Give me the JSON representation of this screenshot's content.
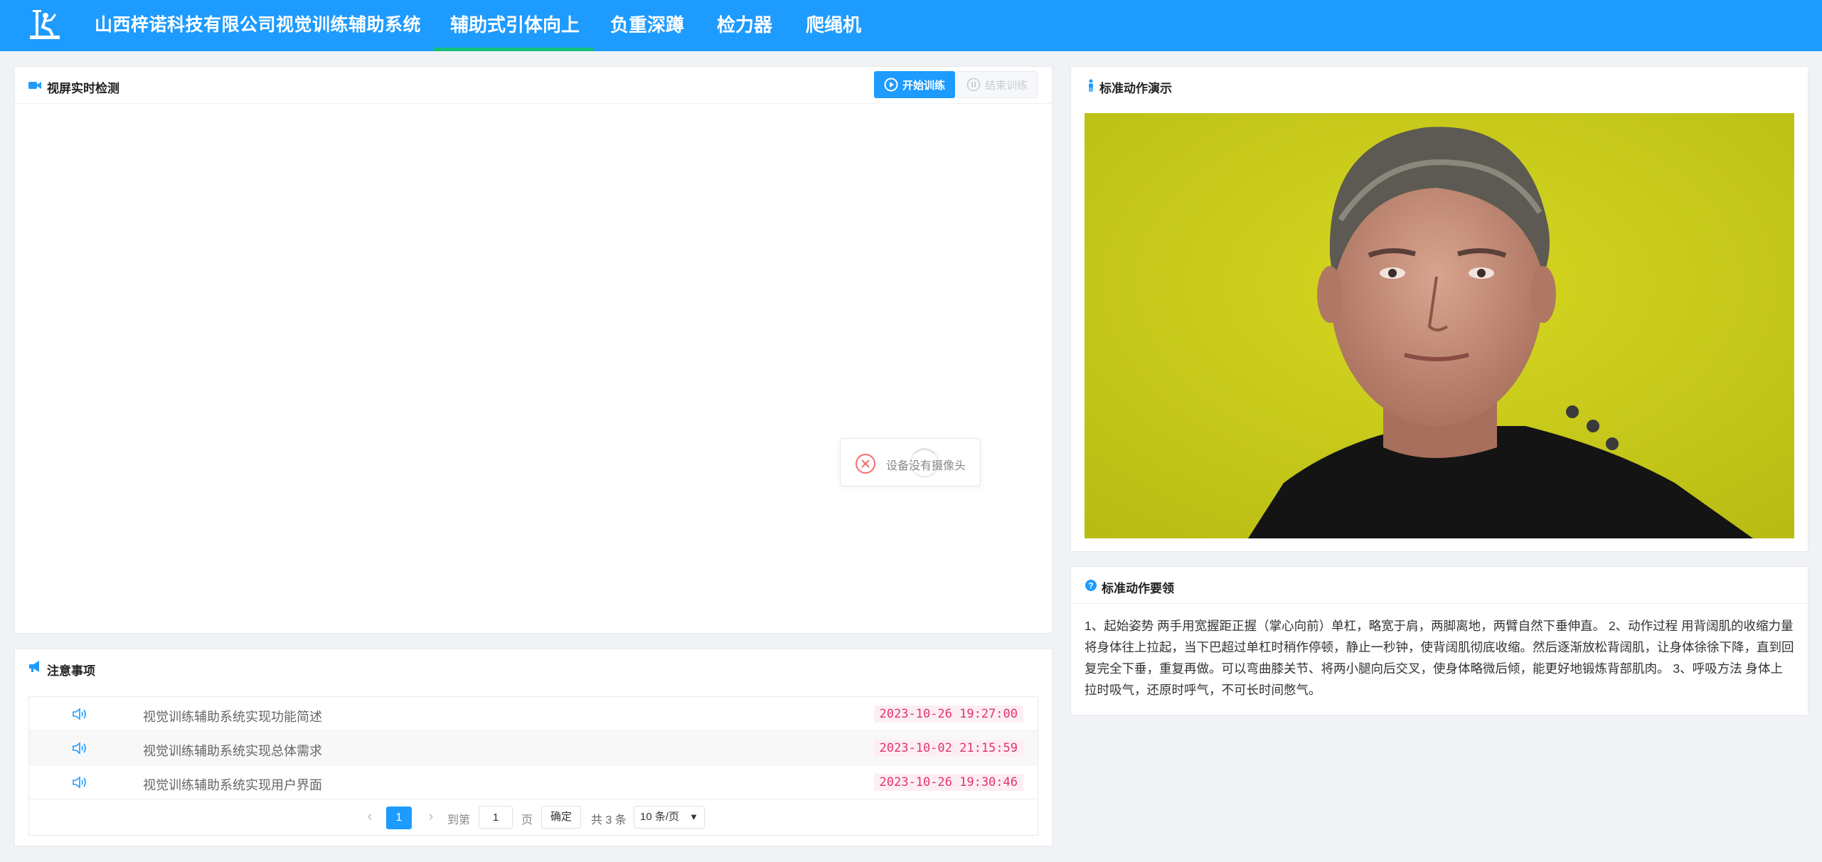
{
  "header": {
    "app_title": "山西梓诺科技有限公司视觉训练辅助系统",
    "nav": [
      {
        "label": "辅助式引体向上",
        "active": true
      },
      {
        "label": "负重深蹲",
        "active": false
      },
      {
        "label": "检力器",
        "active": false
      },
      {
        "label": "爬绳机",
        "active": false
      }
    ],
    "logo_icon": "fitness-machine-icon"
  },
  "camera_panel": {
    "title": "视屏实时检测",
    "icon": "video-camera-icon",
    "start_button": "开始训练",
    "stop_button": "结束训练",
    "toast_message": "设备没有摄像头"
  },
  "demo_panel": {
    "title": "标准动作演示",
    "icon": "person-icon"
  },
  "tips_panel": {
    "title": "标准动作要领",
    "icon": "question-circle-icon",
    "content": "1、起始姿势 两手用宽握距正握（掌心向前）单杠，略宽于肩，两脚离地，两臂自然下垂伸直。 2、动作过程 用背阔肌的收缩力量将身体往上拉起，当下巴超过单杠时稍作停顿，静止一秒钟，使背阔肌彻底收缩。然后逐渐放松背阔肌，让身体徐徐下降，直到回复完全下垂，重复再做。可以弯曲膝关节、将两小腿向后交叉，使身体略微后倾，能更好地锻炼背部肌肉。 3、呼吸方法 身体上拉时吸气，还原时呼气，不可长时间憋气。"
  },
  "notice_panel": {
    "title": "注意事项",
    "icon": "megaphone-icon",
    "rows": [
      {
        "title": "视觉训练辅助系统实现功能简述",
        "date": "2023-10-26 19:27:00"
      },
      {
        "title": "视觉训练辅助系统实现总体需求",
        "date": "2023-10-02 21:15:59"
      },
      {
        "title": "视觉训练辅助系统实现用户界面",
        "date": "2023-10-26 19:30:46"
      }
    ],
    "pagination": {
      "current_page": "1",
      "goto_label": "到第",
      "page_value": "1",
      "page_unit": "页",
      "confirm_label": "确定",
      "total_label": "共 3 条",
      "page_size": "10 条/页"
    }
  },
  "colors": {
    "primary": "#1e9bff",
    "nav_underline": "#13c27a",
    "date_tag_text": "#e0356b",
    "date_tag_bg": "#fdeef3",
    "error": "#f56c6c",
    "video_bg": "#c9cd1a"
  }
}
